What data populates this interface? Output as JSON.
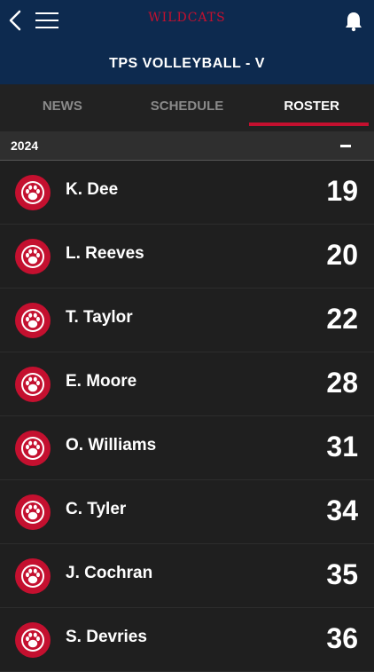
{
  "header": {
    "brand": "WILDCATS",
    "team_title": "TPS VOLLEYBALL - V"
  },
  "tabs": [
    {
      "label": "NEWS"
    },
    {
      "label": "SCHEDULE"
    },
    {
      "label": "ROSTER",
      "active": true
    }
  ],
  "section": {
    "label": "2024"
  },
  "roster": [
    {
      "name": "K. Dee",
      "number": "19"
    },
    {
      "name": "L. Reeves",
      "number": "20"
    },
    {
      "name": "T. Taylor",
      "number": "22"
    },
    {
      "name": "E. Moore",
      "number": "28"
    },
    {
      "name": "O. Williams",
      "number": "31"
    },
    {
      "name": "C. Tyler",
      "number": "34"
    },
    {
      "name": "J. Cochran",
      "number": "35"
    },
    {
      "name": "S. Devries",
      "number": "36"
    }
  ],
  "colors": {
    "header_bg": "#0d2a4f",
    "accent": "#c4102f"
  },
  "icons": [
    "back-icon",
    "menu-icon",
    "bell-icon",
    "paw-icon"
  ]
}
